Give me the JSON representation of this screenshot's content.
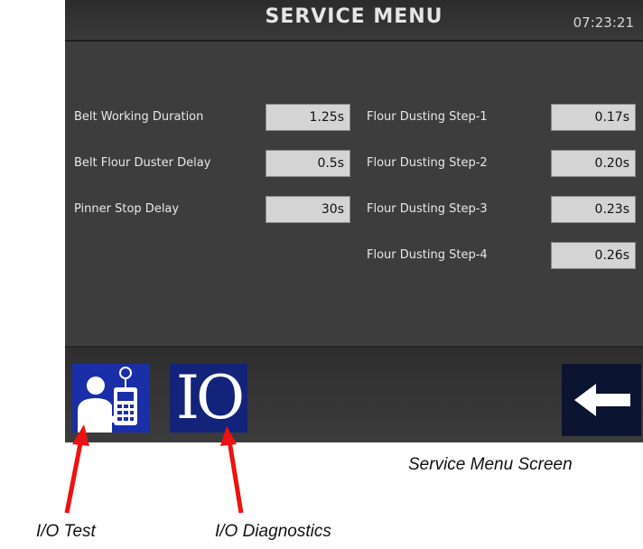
{
  "header": {
    "title": "SERVICE MENU",
    "clock": "07:23:21"
  },
  "left_params": [
    {
      "label": "Belt Working Duration",
      "value": "1.25s"
    },
    {
      "label": "Belt Flour Duster Delay",
      "value": "0.5s"
    },
    {
      "label": "Pinner Stop Delay",
      "value": "30s"
    }
  ],
  "right_params": [
    {
      "label": "Flour Dusting Step-1",
      "value": "0.17s"
    },
    {
      "label": "Flour Dusting Step-2",
      "value": "0.20s"
    },
    {
      "label": "Flour Dusting Step-3",
      "value": "0.23s"
    },
    {
      "label": "Flour Dusting Step-4",
      "value": "0.26s"
    }
  ],
  "toolbar": {
    "io_text": "IO",
    "test_icon": "technician-tester-icon",
    "back_icon": "arrow-left-icon"
  },
  "captions": {
    "screen": "Service Menu Screen",
    "io_test": "I/O Test",
    "io_diagnostics": "I/O Diagnostics"
  },
  "colors": {
    "screen_bg": "#3d3d3d",
    "value_box": "#d4d4d4",
    "button_blue": "#1a2ea8",
    "annotation_arrow": "#ee1111"
  }
}
